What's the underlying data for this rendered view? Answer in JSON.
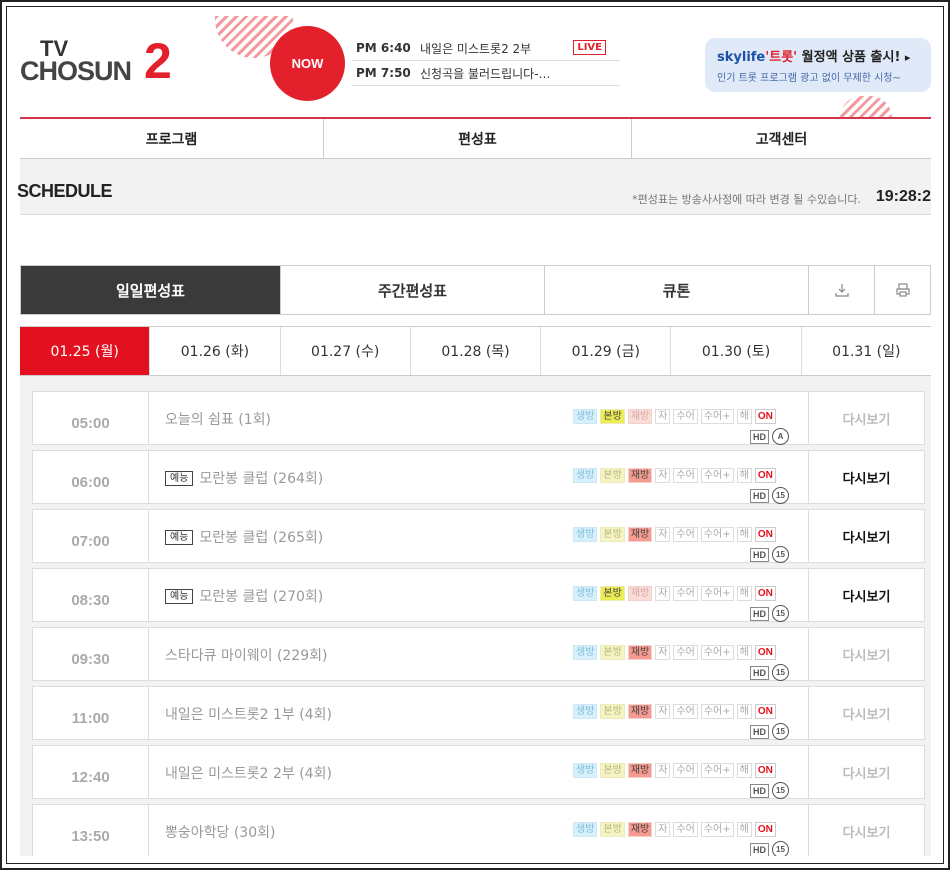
{
  "header": {
    "logo_tv": "TV",
    "logo_chosun": "CHOSUN",
    "logo_num": "2",
    "now_label": "NOW",
    "now_playing": [
      {
        "time": "PM 6:40",
        "title": "내일은 미스트롯2 2부",
        "live": "LIVE"
      },
      {
        "time": "PM 7:50",
        "title": "신청곡을 불러드립니다-…",
        "live": ""
      }
    ],
    "ad": {
      "brand": "skylife",
      "brand_trot": "'트롯'",
      "headline_rest": " 월정액 상품 출시!",
      "arrow": "▸",
      "subline": "인기 트롯 프로그램 광고 없이 무제한 시청~"
    }
  },
  "nav": {
    "items": [
      "프로그램",
      "편성표",
      "고객센터"
    ]
  },
  "schedule_bar": {
    "title": "SCHEDULE",
    "note": "*편성표는 방송사사정에 따라 변경 될 수있습니다.",
    "clock": "19:28:2"
  },
  "tabs": [
    "일일편성표",
    "주간편성표",
    "큐톤"
  ],
  "dates": [
    "01.25 (월)",
    "01.26 (화)",
    "01.27 (수)",
    "01.28 (목)",
    "01.29 (금)",
    "01.30 (토)",
    "01.31 (일)"
  ],
  "badge_labels": {
    "live": "생방",
    "first": "본방",
    "re": "재방",
    "sub": "자",
    "sign": "수어",
    "signplus": "수어+",
    "commentary": "해",
    "on": "ON",
    "hd": "HD"
  },
  "schedule": [
    {
      "time": "05:00",
      "genre": "",
      "title": "오늘의 쉼표 (1회)",
      "first_on": true,
      "re_on": false,
      "rating": "A",
      "replay": "다시보기",
      "replay_on": false
    },
    {
      "time": "06:00",
      "genre": "예능",
      "title": "모란봉 클럽 (264회)",
      "first_on": false,
      "re_on": true,
      "rating": "15",
      "replay": "다시보기",
      "replay_on": true
    },
    {
      "time": "07:00",
      "genre": "예능",
      "title": "모란봉 클럽 (265회)",
      "first_on": false,
      "re_on": true,
      "rating": "15",
      "replay": "다시보기",
      "replay_on": true
    },
    {
      "time": "08:30",
      "genre": "예능",
      "title": "모란봉 클럽 (270회)",
      "first_on": true,
      "re_on": false,
      "rating": "15",
      "replay": "다시보기",
      "replay_on": true
    },
    {
      "time": "09:30",
      "genre": "",
      "title": "스타다큐 마이웨이 (229회)",
      "first_on": false,
      "re_on": true,
      "rating": "15",
      "replay": "다시보기",
      "replay_on": false
    },
    {
      "time": "11:00",
      "genre": "",
      "title": "내일은 미스트롯2 1부 (4회)",
      "first_on": false,
      "re_on": true,
      "rating": "15",
      "replay": "다시보기",
      "replay_on": false
    },
    {
      "time": "12:40",
      "genre": "",
      "title": "내일은 미스트롯2 2부 (4회)",
      "first_on": false,
      "re_on": true,
      "rating": "15",
      "replay": "다시보기",
      "replay_on": false
    },
    {
      "time": "13:50",
      "genre": "",
      "title": "뽕숭아학당 (30회)",
      "first_on": false,
      "re_on": true,
      "rating": "15",
      "replay": "다시보기",
      "replay_on": false
    }
  ]
}
